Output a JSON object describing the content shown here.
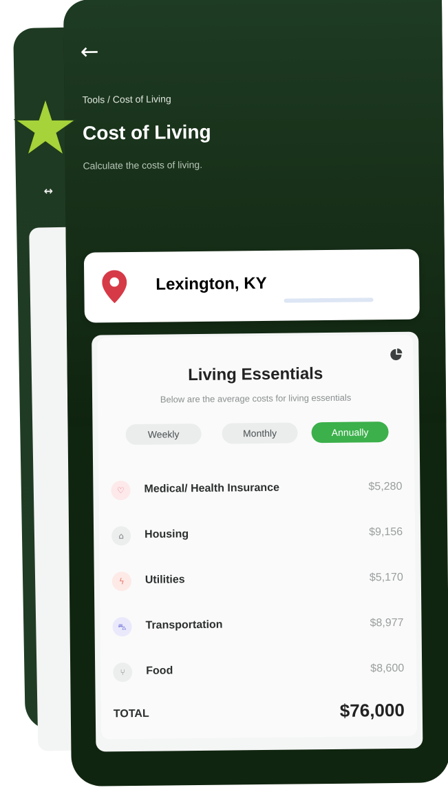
{
  "header": {
    "back_icon": "arrow-left-icon",
    "breadcrumb": "Tools / Cost of Living",
    "title": "Cost of Living",
    "subtitle": "Calculate the costs of living."
  },
  "location": {
    "icon": "map-pin-icon",
    "pin_color": "#d63a47",
    "value": "Lexington, KY"
  },
  "essentials": {
    "title": "Living Essentials",
    "description": "Below are the average costs for living essentials",
    "chart_icon": "pie-chart-icon",
    "tabs": [
      {
        "label": "Weekly",
        "selected": false
      },
      {
        "label": "Monthly",
        "selected": false
      },
      {
        "label": "Annually",
        "selected": true
      }
    ],
    "accent_color": "#3cb04b",
    "items": [
      {
        "label": "Medical/ Health Insurance",
        "amount": "$5,280",
        "icon": "heart-icon",
        "icon_color": "#e0727a",
        "icon_bg": "#fde8ea"
      },
      {
        "label": "Housing",
        "amount": "$9,156",
        "icon": "house-icon",
        "icon_color": "#7a7f7f",
        "icon_bg": "#eceeee"
      },
      {
        "label": "Utilities",
        "amount": "$5,170",
        "icon": "bolt-icon",
        "icon_color": "#e67e73",
        "icon_bg": "#fde9e6"
      },
      {
        "label": "Transportation",
        "amount": "$8,977",
        "icon": "car-icon",
        "icon_color": "#6d6fd6",
        "icon_bg": "#e9e9fb"
      },
      {
        "label": "Food",
        "amount": "$8,600",
        "icon": "cutlery-icon",
        "icon_color": "#7a7f7f",
        "icon_bg": "#eceeee"
      }
    ],
    "total_label": "TOTAL",
    "total_amount": "$76,000"
  },
  "decoration": {
    "star_icon": "star-icon",
    "star_color": "#a6d23a"
  }
}
